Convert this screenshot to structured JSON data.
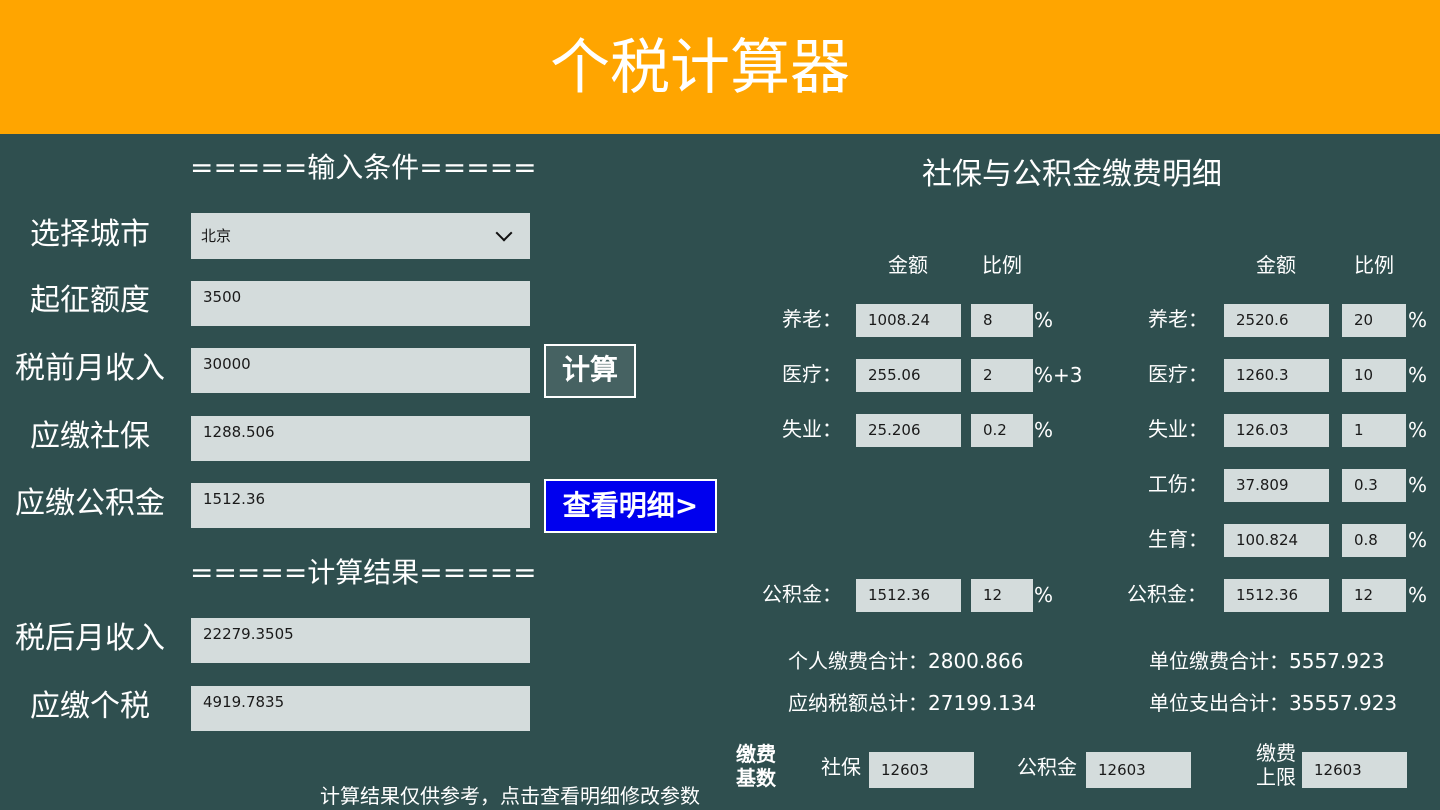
{
  "app": {
    "title": "个税计算器"
  },
  "input_section": {
    "heading": "=====输入条件=====",
    "city": {
      "label": "选择城市",
      "value": "北京"
    },
    "threshold": {
      "label": "起征额度",
      "value": "3500"
    },
    "pretax_income": {
      "label": "税前月收入",
      "value": "30000"
    },
    "social_insurance": {
      "label": "应缴社保",
      "value": "1288.506"
    },
    "housing_fund": {
      "label": "应缴公积金",
      "value": "1512.36"
    },
    "calc_button": "计算",
    "detail_button": "查看明细>"
  },
  "result_section": {
    "heading": "=====计算结果=====",
    "posttax_income": {
      "label": "税后月收入",
      "value": "22279.3505"
    },
    "tax_due": {
      "label": "应缴个税",
      "value": "4919.7835"
    }
  },
  "details": {
    "title": "社保与公积金缴费明细",
    "col_amount": "金额",
    "col_ratio": "比例",
    "personal": {
      "pension": {
        "label": "养老：",
        "amount": "1008.24",
        "ratio": "8",
        "unit": "%"
      },
      "medical": {
        "label": "医疗：",
        "amount": "255.06",
        "ratio": "2",
        "unit": "%+3"
      },
      "unemployment": {
        "label": "失业：",
        "amount": "25.206",
        "ratio": "0.2",
        "unit": "%"
      },
      "fund": {
        "label": "公积金：",
        "amount": "1512.36",
        "ratio": "12",
        "unit": "%"
      }
    },
    "employer": {
      "pension": {
        "label": "养老：",
        "amount": "2520.6",
        "ratio": "20",
        "unit": "%"
      },
      "medical": {
        "label": "医疗：",
        "amount": "1260.3",
        "ratio": "10",
        "unit": "%"
      },
      "unemployment": {
        "label": "失业：",
        "amount": "126.03",
        "ratio": "1",
        "unit": "%"
      },
      "injury": {
        "label": "工伤：",
        "amount": "37.809",
        "ratio": "0.3",
        "unit": "%"
      },
      "maternity": {
        "label": "生育：",
        "amount": "100.824",
        "ratio": "0.8",
        "unit": "%"
      },
      "fund": {
        "label": "公积金：",
        "amount": "1512.36",
        "ratio": "12",
        "unit": "%"
      }
    },
    "summary": {
      "personal_total": "个人缴费合计：2800.866",
      "taxable_total": "应纳税额总计：27199.134",
      "employer_total": "单位缴费合计：5557.923",
      "employer_expense": "单位支出合计：35557.923"
    },
    "base": {
      "label": "缴费基数",
      "social_label": "社保",
      "social_value": "12603",
      "fund_label": "公积金",
      "fund_value": "12603",
      "cap_label": "缴费上限",
      "cap_value": "12603"
    }
  },
  "footer_note": "计算结果仅供参考，点击查看明细修改参数",
  "colors": {
    "header": "#ffa500",
    "background": "#2f4f4f",
    "field": "#d4dcdc",
    "detail_button": "#0000ee"
  }
}
